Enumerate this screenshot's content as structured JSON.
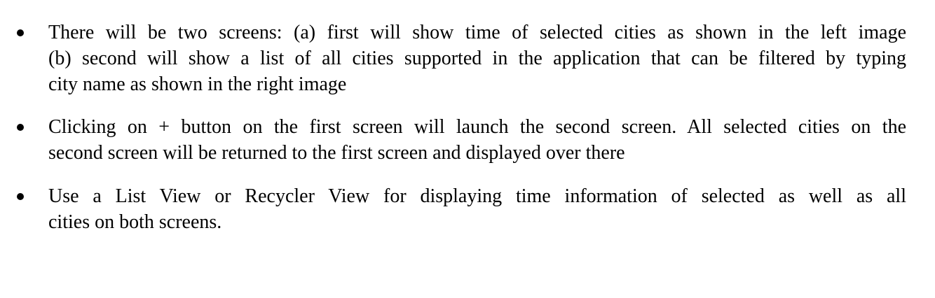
{
  "document": {
    "bullets": [
      {
        "lines": [
          "There will be two screens: (a) first will show time of selected cities as shown in the left image",
          "(b) second will show a list of all cities supported in the application that can be filtered by typing",
          "city name as shown in the right image"
        ]
      },
      {
        "lines": [
          "Clicking on + button on the first screen will launch the second screen. All selected cities on the",
          "second screen will be returned to the first screen and displayed over there"
        ]
      },
      {
        "lines": [
          "Use a List View or Recycler View for displaying time information of selected as well as all",
          "cities on both screens."
        ]
      }
    ]
  }
}
